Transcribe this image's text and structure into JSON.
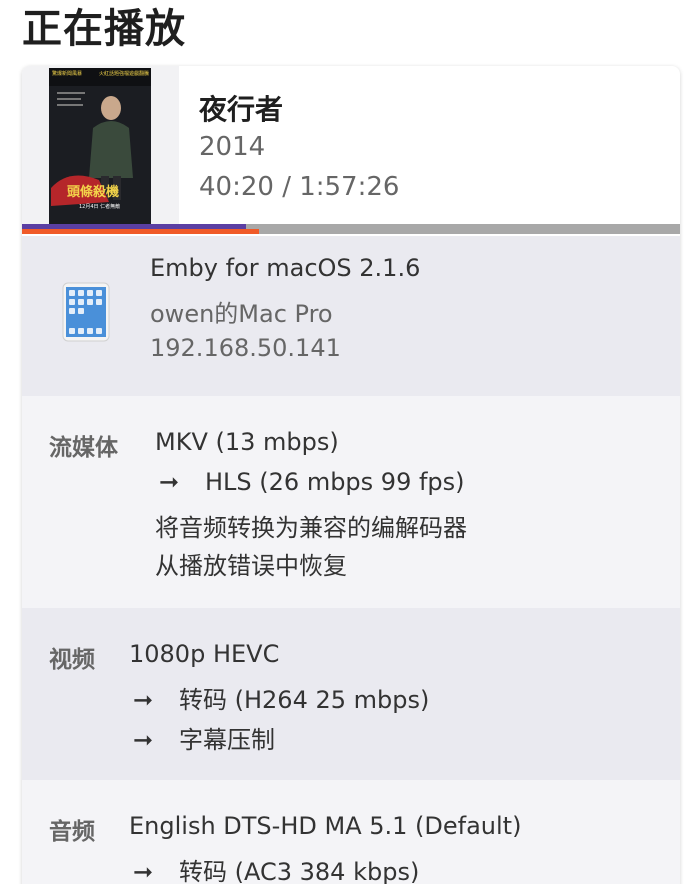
{
  "header": {
    "title": "正在播放"
  },
  "media": {
    "title": "夜行者",
    "year": "2014",
    "time": "40:20 / 1:57:26",
    "poster": {
      "heading": "頭條殺機",
      "tagline_left": "驚爆新聞風暴",
      "tagline_right": "火紅話題強檔遊戲翻騰",
      "release": "12月4日 仁者無敵",
      "colors": {
        "bg": "#1b1d22",
        "text": "#f2d34a",
        "car": "#b5262a"
      }
    },
    "progress": {
      "buffered": 0.34,
      "played": 0.36
    }
  },
  "progress_colors": {
    "track": "#a8a8a8",
    "buffered": "#5b3fa3",
    "played": "#f05a28"
  },
  "device": {
    "icon": "tablet-icon",
    "client": "Emby for macOS 2.1.6",
    "name": "owen的Mac Pro",
    "ip": "192.168.50.141"
  },
  "stream": {
    "label": "流媒体",
    "lines": [
      "MKV (13 mbps)",
      "HLS (26 mbps 99 fps)",
      "将音频转换为兼容的编解码器",
      "从播放错误中恢复"
    ]
  },
  "video": {
    "label": "视频",
    "lines": [
      "1080p HEVC",
      "转码 (H264 25 mbps)",
      "字幕压制"
    ]
  },
  "audio": {
    "label": "音频",
    "lines": [
      "English DTS-HD MA 5.1 (Default)",
      "转码 (AC3 384 kbps)"
    ]
  },
  "arrow_glyph": "➞"
}
